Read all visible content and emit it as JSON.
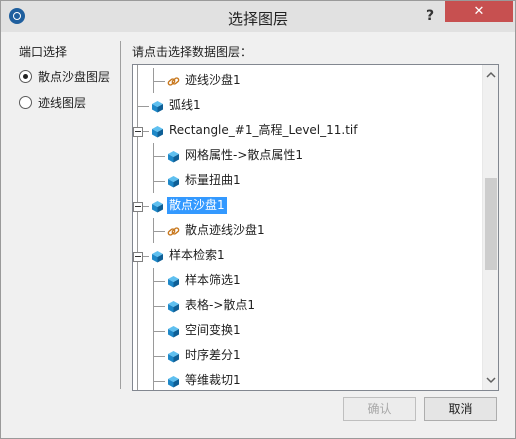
{
  "window": {
    "title": "选择图层",
    "help_label": "?",
    "close_label": "✕"
  },
  "left_panel": {
    "group_label": "端口选择",
    "options": [
      {
        "label": "散点沙盘图层",
        "checked": true
      },
      {
        "label": "迹线图层",
        "checked": false
      }
    ]
  },
  "right_panel": {
    "prompt": "请点击选择数据图层："
  },
  "tree": {
    "nodes": [
      {
        "label": "迹线沙盘1",
        "icon": "link-icon",
        "level": 1,
        "toggle": false
      },
      {
        "label": "弧线1",
        "icon": "cube-icon",
        "level": 0,
        "toggle": false
      },
      {
        "label": "Rectangle_#1_高程_Level_11.tif",
        "icon": "cube-icon",
        "level": 0,
        "toggle": true
      },
      {
        "label": "网格属性->散点属性1",
        "icon": "cube-icon",
        "level": 1,
        "toggle": false
      },
      {
        "label": "标量扭曲1",
        "icon": "cube-icon",
        "level": 1,
        "toggle": false
      },
      {
        "label": "散点沙盘1",
        "icon": "cube-icon",
        "level": 0,
        "toggle": true,
        "selected": true
      },
      {
        "label": "散点迹线沙盘1",
        "icon": "link-icon",
        "level": 1,
        "toggle": false
      },
      {
        "label": "样本检索1",
        "icon": "cube-icon",
        "level": 0,
        "toggle": true
      },
      {
        "label": "样本筛选1",
        "icon": "cube-icon",
        "level": 1,
        "toggle": false
      },
      {
        "label": "表格->散点1",
        "icon": "cube-icon",
        "level": 1,
        "toggle": false
      },
      {
        "label": "空间变换1",
        "icon": "cube-icon",
        "level": 1,
        "toggle": false
      },
      {
        "label": "时序差分1",
        "icon": "cube-icon",
        "level": 1,
        "toggle": false
      },
      {
        "label": "等维裁切1",
        "icon": "cube-icon",
        "level": 1,
        "toggle": false
      }
    ]
  },
  "buttons": {
    "ok_label": "确认",
    "cancel_label": "取消"
  },
  "colors": {
    "selection": "#3399ff",
    "cube": "#1e88c8",
    "link": "#c8781e",
    "close": "#c75050"
  }
}
